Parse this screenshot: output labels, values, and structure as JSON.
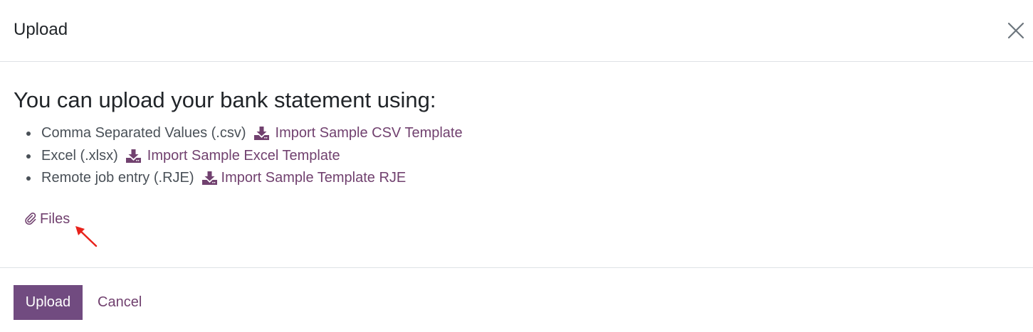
{
  "dialog": {
    "title": "Upload"
  },
  "body": {
    "heading": "You can upload your bank statement using:",
    "formats": [
      {
        "label": "Comma Separated Values (.csv)",
        "link": "Import Sample CSV Template",
        "icon": "download-icon"
      },
      {
        "label": "Excel (.xlsx)",
        "link": "Import Sample Excel Template",
        "icon": "download-icon"
      },
      {
        "label": "Remote job entry (.RJE)",
        "link": "Import Sample Template RJE",
        "icon": "download-icon"
      }
    ],
    "files": {
      "label": "Files",
      "icon": "paperclip-icon"
    }
  },
  "footer": {
    "upload_label": "Upload",
    "cancel_label": "Cancel"
  },
  "colors": {
    "accent": "#714b80",
    "link": "#71416f",
    "annotation_arrow": "#e8221b"
  }
}
